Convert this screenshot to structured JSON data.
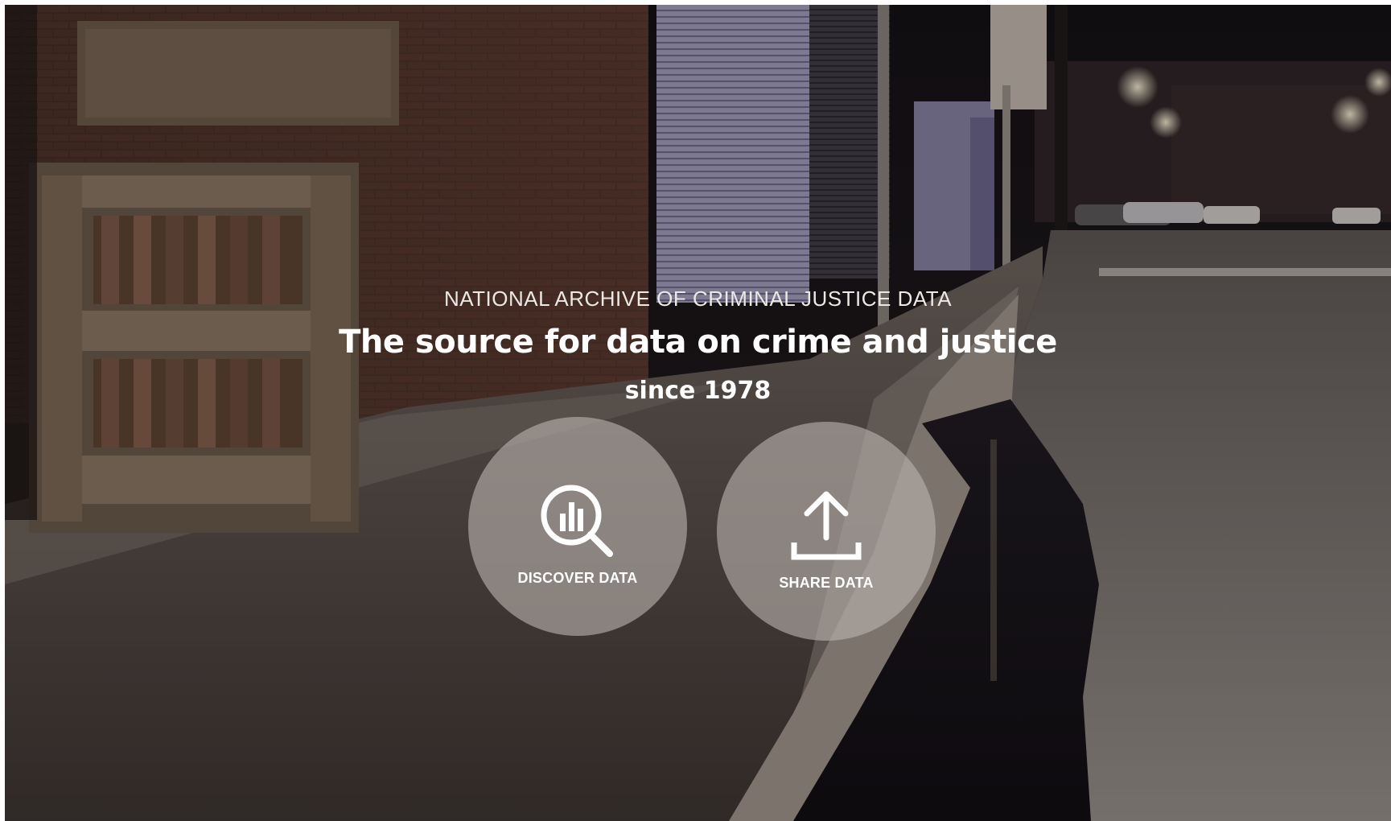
{
  "hero": {
    "eyebrow": "NATIONAL ARCHIVE OF CRIMINAL JUSTICE DATA",
    "headline": "The source for data on crime and justice",
    "since": "since 1978",
    "background": "night-street-sidewalk-photo"
  },
  "actions": {
    "discover": {
      "label": "DISCOVER DATA",
      "icon": "search-chart-icon"
    },
    "share": {
      "label": "SHARE DATA",
      "icon": "upload-icon"
    }
  },
  "colors": {
    "text": "#ffffff",
    "button_fill": "#b9b2ac",
    "overlay": "#14100e"
  }
}
